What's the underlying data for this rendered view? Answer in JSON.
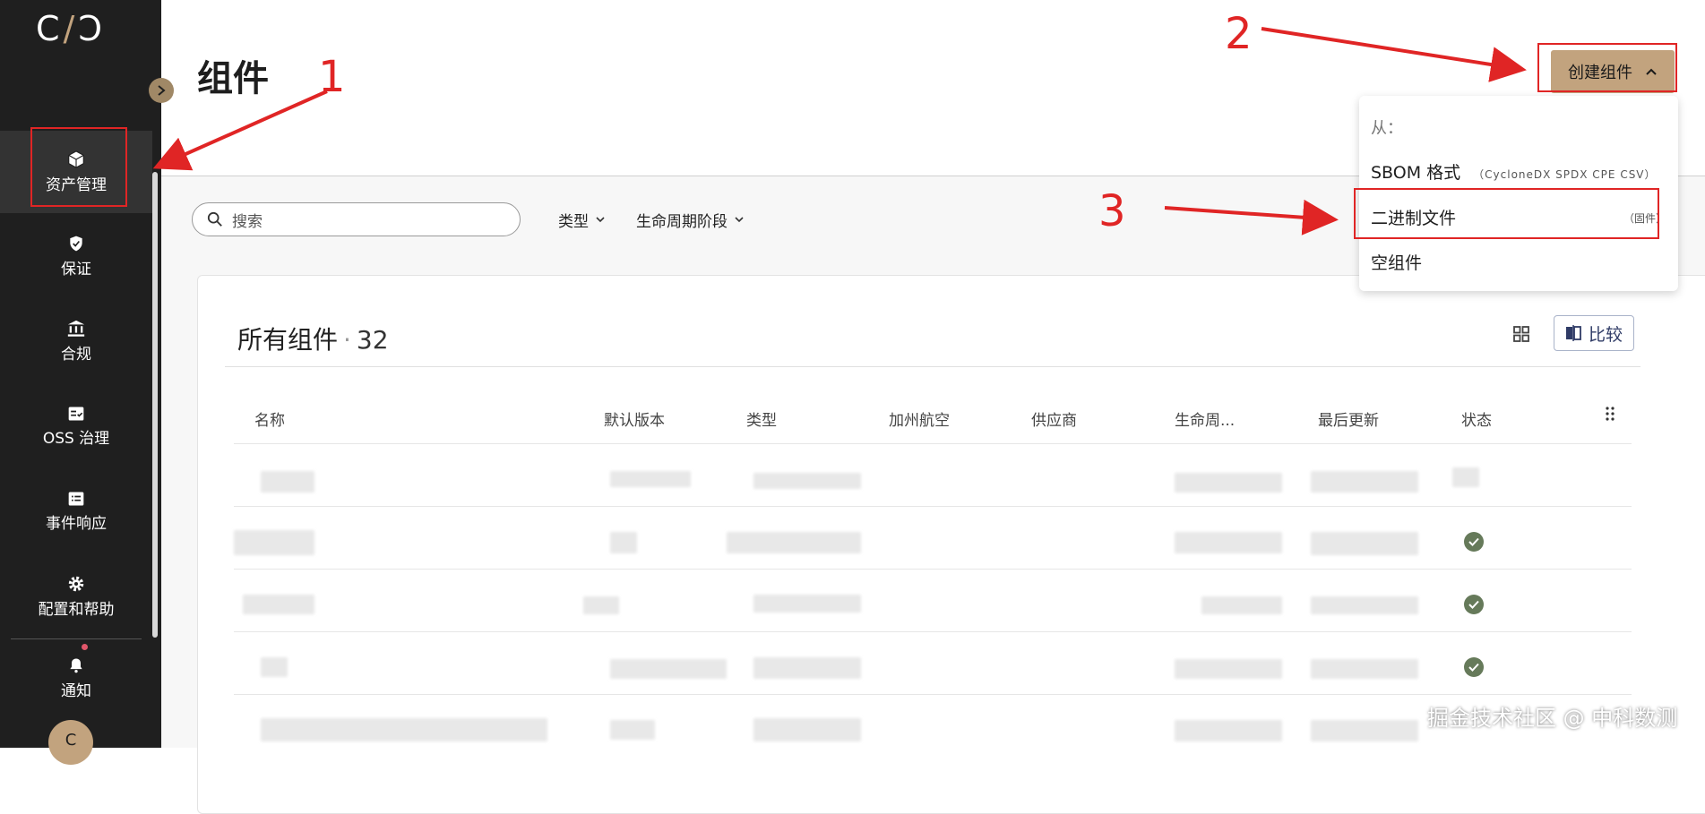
{
  "app": {
    "logo_text": "C/Ↄ"
  },
  "sidebar": {
    "items": [
      {
        "label": "资产管理",
        "icon": "box-icon",
        "active": true
      },
      {
        "label": "保证",
        "icon": "shield-icon",
        "active": false
      },
      {
        "label": "合规",
        "icon": "bank-icon",
        "active": false
      },
      {
        "label": "OSS 治理",
        "icon": "checklist-icon",
        "active": false
      },
      {
        "label": "事件响应",
        "icon": "list-icon",
        "active": false
      },
      {
        "label": "配置和帮助",
        "icon": "gear-icon",
        "active": false
      },
      {
        "label": "通知",
        "icon": "bell-icon",
        "active": false
      }
    ],
    "avatar_initial": "C"
  },
  "header": {
    "title": "组件",
    "create_button": "创建组件"
  },
  "toolbar": {
    "search_placeholder": "搜索",
    "filter_type": "类型",
    "filter_lifecycle": "生命周期阶段"
  },
  "card": {
    "title": "所有组件",
    "count": "32",
    "compare_button": "比较",
    "columns": [
      "名称",
      "默认版本",
      "类型",
      "加州航空",
      "供应商",
      "生命周...",
      "最后更新",
      "状态"
    ]
  },
  "dropdown": {
    "from_label": "从：",
    "items": [
      {
        "label": "SBOM 格式",
        "hint": "（CycloneDX SPDX CPE CSV）"
      },
      {
        "label": "二进制文件",
        "hint": "（固件）"
      },
      {
        "label": "空组件",
        "hint": ""
      }
    ]
  },
  "annotations": [
    "1",
    "2",
    "3"
  ],
  "watermark": "掘金技术社区 @ 中科数测",
  "colors": {
    "sidebar_bg": "#1f1f1f",
    "accent": "#c2a37e",
    "annotation_red": "#e02525",
    "status_ok": "#667a5a"
  }
}
